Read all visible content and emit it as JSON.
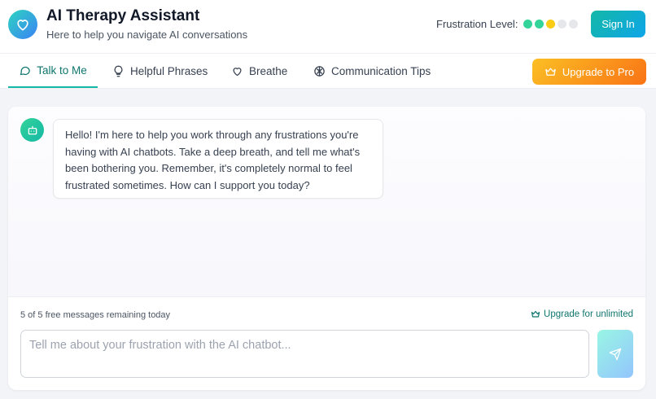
{
  "header": {
    "title": "AI Therapy Assistant",
    "subtitle": "Here to help you navigate AI conversations",
    "logo_icon": "heart-icon",
    "frustration_label": "Frustration Level:",
    "frustration_level": 3,
    "frustration_max": 5,
    "frustration_colors": [
      "#34d399",
      "#34d399",
      "#facc15",
      "#e5e7eb",
      "#e5e7eb"
    ],
    "signin_label": "Sign In"
  },
  "nav": {
    "tabs": [
      {
        "label": "Talk to Me",
        "icon": "chat-bubble-icon",
        "active": true
      },
      {
        "label": "Helpful Phrases",
        "icon": "lightbulb-icon",
        "active": false
      },
      {
        "label": "Breathe",
        "icon": "heart-outline-icon",
        "active": false
      },
      {
        "label": "Communication Tips",
        "icon": "brain-icon",
        "active": false
      }
    ],
    "upgrade_label": "Upgrade to Pro",
    "upgrade_icon": "crown-icon"
  },
  "chat": {
    "bot_avatar_icon": "bot-icon",
    "messages": [
      {
        "sender": "bot",
        "text": "Hello! I'm here to help you work through any frustrations you're having with AI chatbots. Take a deep breath, and tell me what's been bothering you. Remember, it's completely normal to feel frustrated sometimes. How can I support you today?"
      }
    ],
    "remaining_text": "5 of 5 free messages remaining today",
    "upgrade_link_label": "Upgrade for unlimited",
    "input_placeholder": "Tell me about your frustration with the AI chatbot...",
    "input_value": "",
    "send_icon": "send-icon"
  },
  "colors": {
    "accent_teal": "#14b8a6",
    "accent_orange": "#f97316",
    "accent_blue": "#3b82f6"
  }
}
